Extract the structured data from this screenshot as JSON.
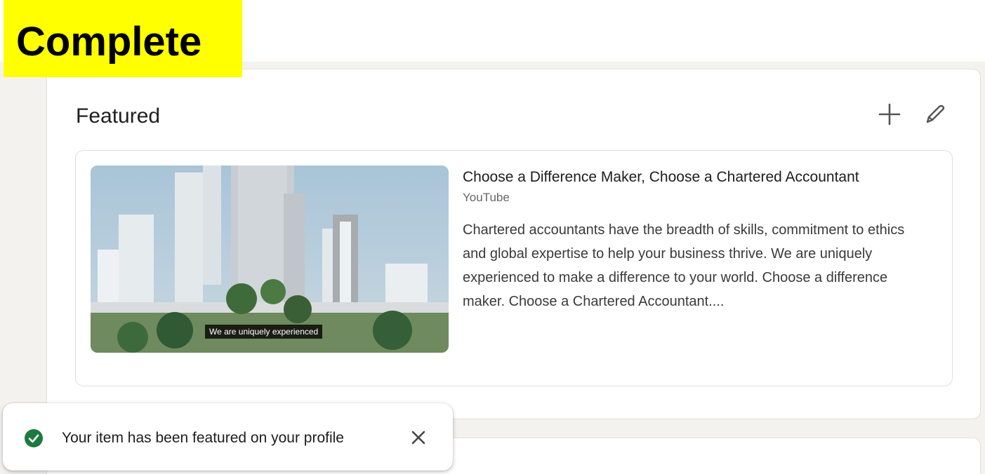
{
  "overlay": {
    "label": "Complete"
  },
  "featured": {
    "title": "Featured",
    "add_icon": "plus-icon",
    "edit_icon": "pencil-icon",
    "item": {
      "title": "Choose a Difference Maker, Choose a Chartered Accountant",
      "source": "YouTube",
      "description": "Chartered accountants have the breadth of skills, commitment to ethics and global expertise to help your business thrive. We are uniquely experienced to make a difference to your world. Choose a difference maker. Choose a Chartered Accountant....",
      "thumbnail_caption": "We are uniquely experienced"
    }
  },
  "toast": {
    "message": "Your item has been featured on your profile",
    "status_icon": "check-circle-icon",
    "close_icon": "close-icon"
  },
  "colors": {
    "highlight": "#ffff00",
    "success": "#1d7a3f",
    "page_bg": "#f4f2ee"
  }
}
